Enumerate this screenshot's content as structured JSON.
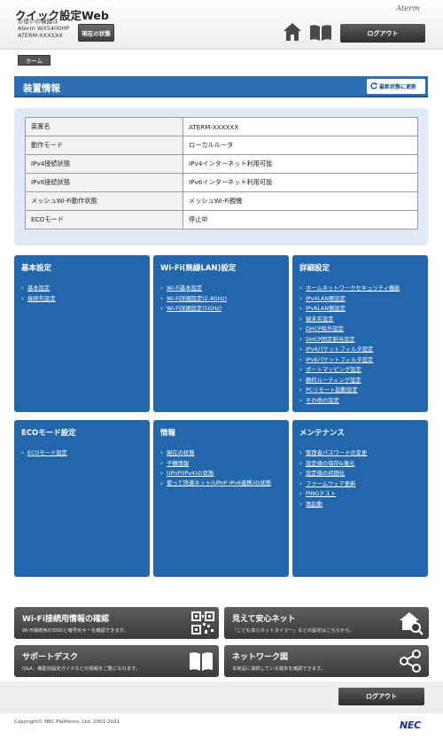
{
  "header": {
    "app_title": "クイック設定Web",
    "device_line1": "お使いの機器は",
    "device_line2": "Aterm WX5400HP",
    "device_line3": "ATERM-XXXXXX",
    "status_button": "現在の状態",
    "brand": "Aterm",
    "logout": "ログアウト"
  },
  "breadcrumb": {
    "home": "ホーム"
  },
  "page": {
    "title": "装置情報",
    "refresh_button": "最新状態に更新"
  },
  "device_info": [
    {
      "key": "装置名",
      "value": "ATERM-XXXXXX"
    },
    {
      "key": "動作モード",
      "value": "ローカルルータ"
    },
    {
      "key": "IPv4接続状態",
      "value": "IPv4インターネット利用可能"
    },
    {
      "key": "IPv6接続状態",
      "value": "IPv6インターネット利用可能"
    },
    {
      "key": "メッシュWi-Fi動作状態",
      "value": "メッシュWi-Fi親機"
    },
    {
      "key": "ECOモード",
      "value": "停止中"
    }
  ],
  "tiles": {
    "basic": {
      "title": "基本設定",
      "links": [
        "基本設定",
        "接続先設定"
      ]
    },
    "wifi": {
      "title": "Wi-Fi(無線LAN)設定",
      "links": [
        "Wi-Fi基本設定",
        "Wi-Fi詳細設定(2.4GHz)",
        "Wi-Fi詳細設定(5GHz)"
      ]
    },
    "advanced": {
      "title": "詳細設定",
      "links": [
        "ホームネットワークセキュリティ機能",
        "IPv4LAN側設定",
        "IPv6LAN側設定",
        "端末名設定",
        "DHCP除外設定",
        "DHCP固定割当設定",
        "IPv4パケットフィルタ設定",
        "IPv6パケットフィルタ設定",
        "ポートマッピング設定",
        "静的ルーティング設定",
        "PCリモート起動設定",
        "その他の設定"
      ]
    },
    "eco": {
      "title": "ECOモード設定",
      "links": [
        "ECOモード設定"
      ]
    },
    "info": {
      "title": "情報",
      "links": [
        "現在の状態",
        "子機情報",
        "UPnP(IPv4)の状態",
        "使って快適ネット(UPnP IPv6連携)の状態"
      ]
    },
    "maintenance": {
      "title": "メンテナンス",
      "links": [
        "管理者パスワードの変更",
        "設定値の保存&復元",
        "設定値の初期化",
        "ファームウェア更新",
        "PINGテスト",
        "再起動"
      ]
    }
  },
  "cards": {
    "wifi_info": {
      "title": "Wi-Fi接続用情報の確認",
      "sub": "Wi-Fi接続用のSSIDと暗号化キーを確認できます。",
      "icon": "qr-code-icon"
    },
    "mieru": {
      "title": "見えて安心ネット",
      "sub": "「こども安心ネットタイマー」などの設定はこちらから。",
      "icon": "house-search-icon"
    },
    "support": {
      "title": "サポートデスク",
      "sub": "Q&A、機能別設定ガイドなどの情報をご覧になれます。",
      "icon": "book-icon"
    },
    "network_map": {
      "title": "ネットワーク図",
      "sub": "本商品に接続している端末を確認できます。",
      "icon": "share-network-icon"
    }
  },
  "footer": {
    "logout": "ログアウト",
    "copyright": "Copyright© NEC Platforms, Ltd. 2001-2021",
    "logo": "NEC"
  }
}
